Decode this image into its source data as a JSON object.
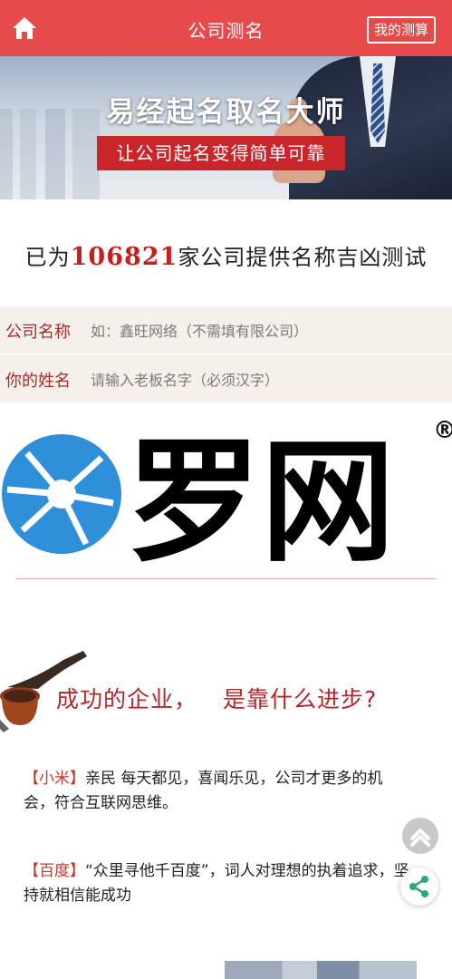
{
  "header": {
    "title": "公司测名",
    "my_test_label": "我的测算"
  },
  "banner": {
    "slogan": "易经起名取名大师",
    "subtitle": "让公司起名变得简单可靠"
  },
  "stats": {
    "prefix": "已为",
    "count": "106821",
    "suffix": "家公司提供名称吉凶测试"
  },
  "form": {
    "company": {
      "label": "公司名称",
      "placeholder": "如：鑫旺网络（不需填有限公司）"
    },
    "owner": {
      "label": "你的姓名",
      "placeholder": "请输入老板名字（必须汉字）"
    }
  },
  "watermark": {
    "text": "罗网",
    "mark": "®"
  },
  "section": {
    "heading_a": "成功的企业，",
    "heading_b": "是靠什么进步?"
  },
  "items": [
    {
      "brand": "【小米】",
      "text": "亲民 每天都见，喜闻乐见，公司才更多的机会，符合互联网思维。"
    },
    {
      "brand": "【百度】",
      "text": "“众里寻他千百度”，词人对理想的执着追求，坚持就相信能成功"
    }
  ],
  "colors": {
    "header_bg": "#e64a4a",
    "accent_red": "#c81e1e",
    "field_bg": "#f5f0ea",
    "watermark_blue": "#2f8fd8"
  },
  "icons": {
    "home": "home-icon",
    "scroll_top": "chevron-up-icon",
    "share": "share-icon",
    "pipe": "pipe-icon"
  }
}
